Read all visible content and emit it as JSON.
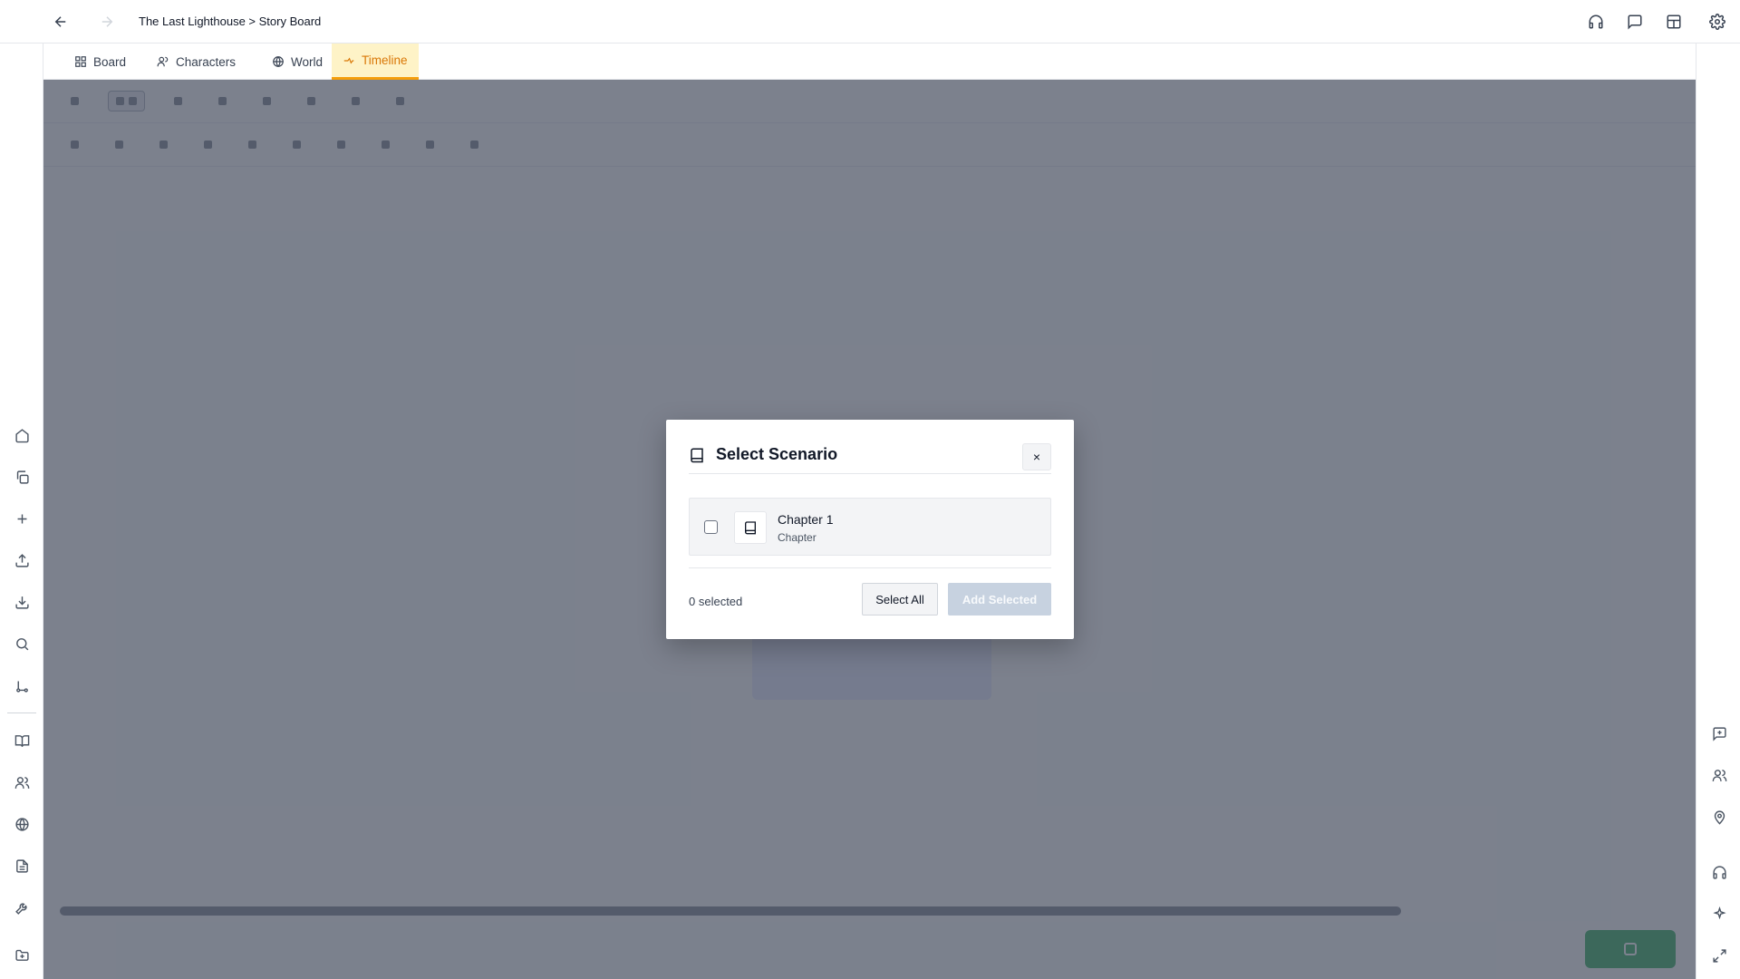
{
  "titlebar": {
    "breadcrumb": "The Last Lighthouse > Story Board"
  },
  "tabs": [
    {
      "label": "Board",
      "icon": "grid-icon"
    },
    {
      "label": "Characters",
      "icon": "users-icon"
    },
    {
      "label": "World",
      "icon": "globe-icon"
    },
    {
      "label": "Timeline",
      "icon": "timeline-icon",
      "active": true
    }
  ],
  "modal": {
    "title": "Select Scenario",
    "close_label": "×",
    "items": [
      {
        "name": "Chapter 1",
        "type": "Chapter",
        "checked": false
      }
    ],
    "selected_count": "0 selected",
    "select_all_label": "Select All",
    "add_selected_label": "Add Selected"
  },
  "colors": {
    "accent": "#f59e0b",
    "overlay": "#4b5263",
    "primary_disabled": "#c7d2e0"
  }
}
